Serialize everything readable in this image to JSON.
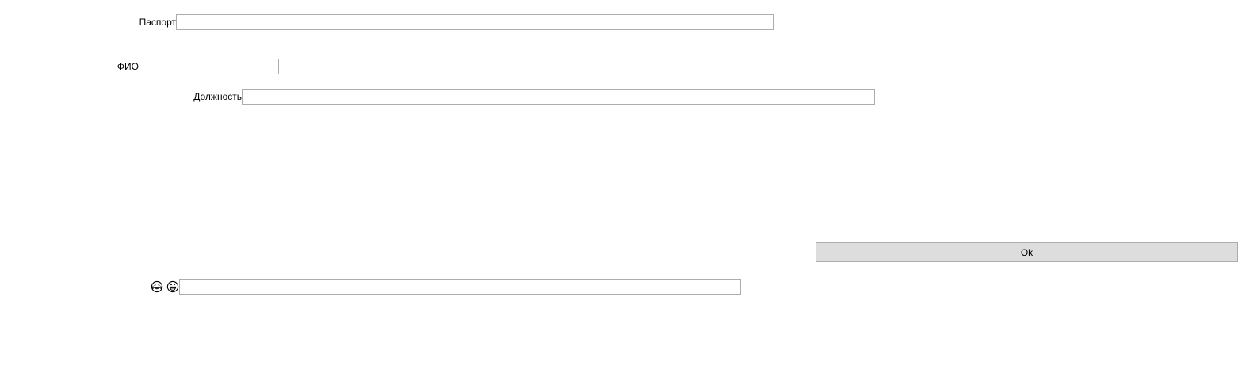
{
  "form": {
    "passport": {
      "label": "Паспорт",
      "value": ""
    },
    "full_name": {
      "label": "ФИО",
      "value": ""
    },
    "position": {
      "label": "Должность",
      "value": ""
    },
    "ok_label": "Ok",
    "extra_field": {
      "value": "",
      "icons": [
        "laughing-tears-icon",
        "grinning-face-icon"
      ]
    }
  }
}
